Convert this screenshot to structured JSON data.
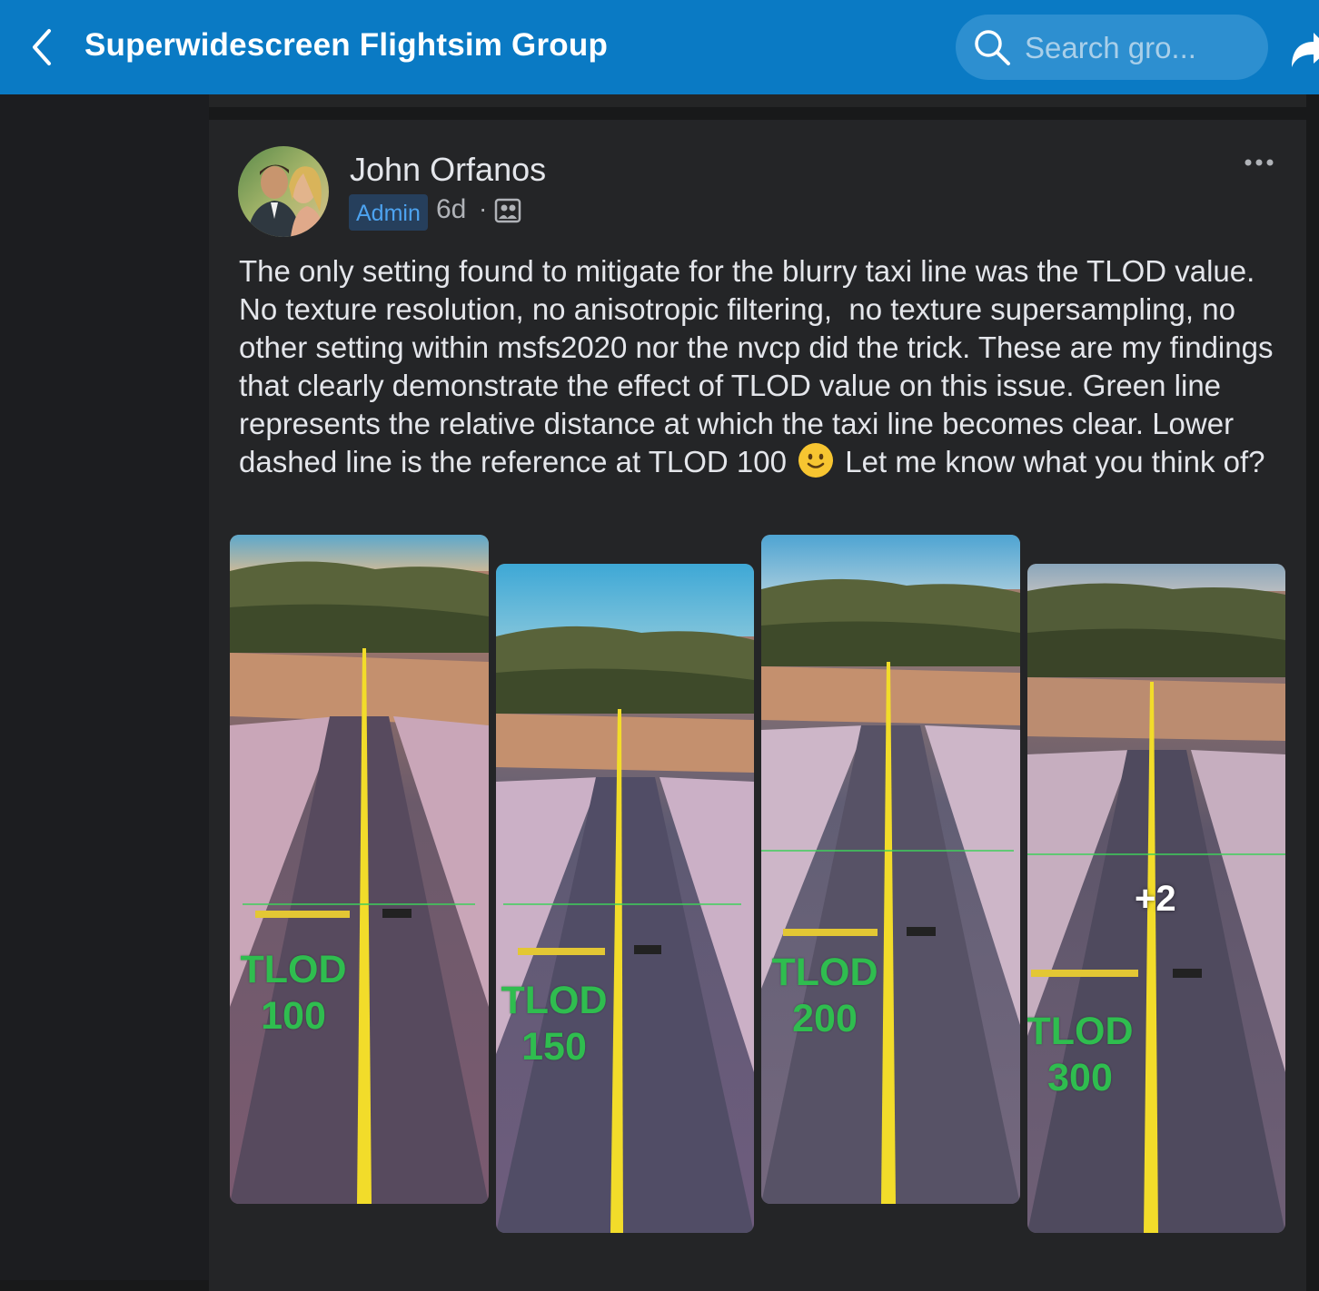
{
  "header": {
    "title": "Superwidescreen Flightsim Group",
    "search_placeholder": "Search gro..."
  },
  "post": {
    "author": "John Orfanos",
    "badge": "Admin",
    "time": "6d",
    "separator": "·",
    "text_before_emoji": "The only setting found to mitigate for the blurry taxi line was the TLOD value. No texture resolution, no anisotropic filtering,  no texture supersampling, no other setting within msfs2020 nor the nvcp did the trick. These are my findings that clearly demonstrate the effect of TLOD value on this issue. Green line represents the relative distance at which the taxi line becomes clear. Lower dashed line is the reference at TLOD 100 ",
    "text_after_emoji": " Let me know what you think of?",
    "photos": [
      {
        "label_line1": "TLOD",
        "label_line2": "100"
      },
      {
        "label_line1": "TLOD",
        "label_line2": "150"
      },
      {
        "label_line1": "TLOD",
        "label_line2": "200"
      },
      {
        "label_line1": "TLOD",
        "label_line2": "300"
      }
    ],
    "more_photos": "+2"
  },
  "colors": {
    "topbar": "#0a7ac4",
    "label_green": "#2fbd4f",
    "taxi_line_yellow": "#f2dc2a"
  }
}
